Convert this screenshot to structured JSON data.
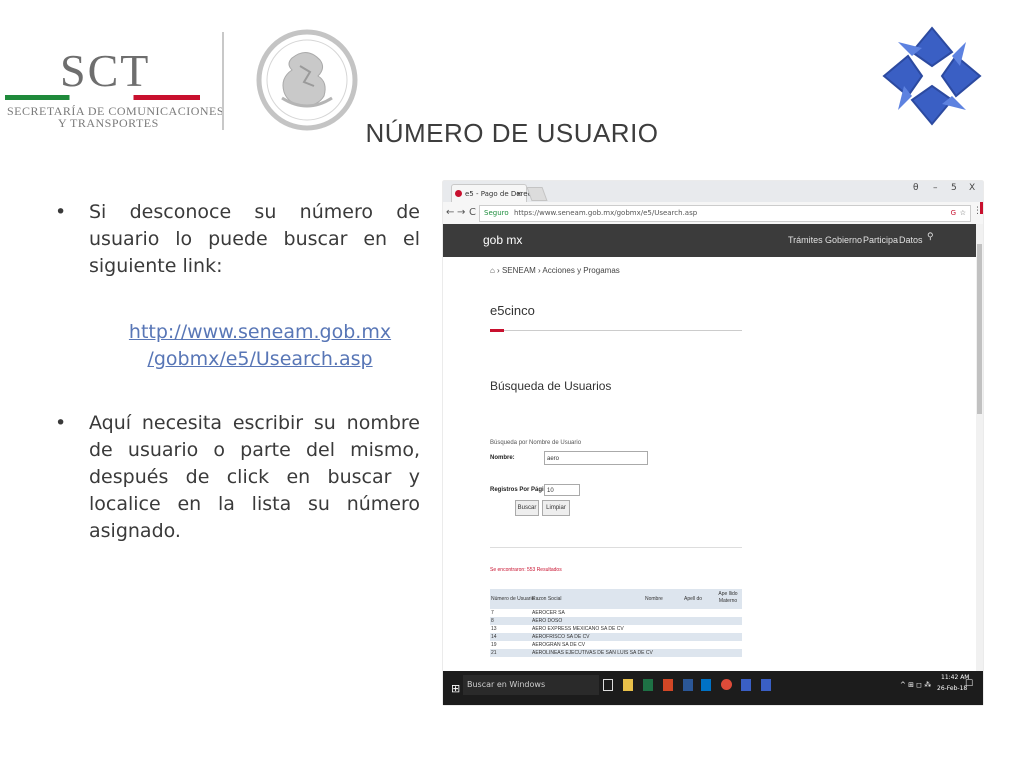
{
  "header": {
    "sct_letters": "SCT",
    "sct_line1": "SECRETARÍA DE COMUNICACIONES",
    "sct_line2": "Y TRANSPORTES",
    "seal_text": "ESTADOS UNIDOS MEXICANOS",
    "title": "NÚMERO DE USUARIO"
  },
  "content": {
    "bullet_symbol": "•",
    "bullet1": "Si desconoce su número de usuario lo puede buscar en el siguiente link:",
    "link": "http://www.seneam.gob.mx/gobmx/e5/Usearch.asp",
    "link_line1": "http://www.seneam.gob.mx",
    "link_line2": "/gobmx/e5/Usearch.asp",
    "bullet2": "Aquí necesita escribir su nombre de usuario o parte del mismo, después de click en buscar y localice en la lista su número asignado."
  },
  "browser": {
    "tab_title": "e5 - Pago de Derechos",
    "tab_close": "×",
    "win_user": "θ",
    "win_min": "–",
    "win_max": "5",
    "win_close": "X",
    "back": "←",
    "forward": "→",
    "reload": "C",
    "secure_label": "Seguro",
    "url": "https://www.seneam.gob.mx/gobmx/e5/Usearch.asp",
    "star": "☆",
    "menu": "⋮"
  },
  "site": {
    "brand": "gob mx",
    "nav": [
      "Trámites",
      "Gobierno",
      "Participa",
      "Datos"
    ],
    "search_icon": "⚲",
    "breadcrumb": "⌂ › SENEAM › Acciones y Progamas",
    "section": "e5cinco",
    "heading": "Búsqueda de Usuarios",
    "form_caption": "Búsqueda por Nombre de Usuario",
    "name_label": "Nombre:",
    "name_value": "aero",
    "reg_label": "Registros Por Página:",
    "reg_value": "10",
    "buscar": "Buscar",
    "limpiar": "Limpiar",
    "results": "Se encontraron: 553 Resultados",
    "table": {
      "headers": [
        "Número de Usuario",
        "Razon Social",
        "Nombre",
        "Apell do",
        "Ape llido Materno"
      ],
      "rows": [
        [
          "7",
          "AEROCER SA"
        ],
        [
          "8",
          "AERO DOSO"
        ],
        [
          "13",
          "AERO EXPRESS MEXICANO SA DE CV"
        ],
        [
          "14",
          "AEROFRISCO SA DE CV"
        ],
        [
          "19",
          "AEROGRAN SA DE CV"
        ],
        [
          "21",
          "AEROLINEAS EJECUTIVAS DE SAN LUIS SA DE CV"
        ]
      ]
    }
  },
  "taskbar": {
    "start": "⊞",
    "search": "Buscar en Windows",
    "tray": "^ ⊞ ◻ ⁂",
    "time": "11:42 AM",
    "date": "26-Feb-18",
    "notif": "☐"
  },
  "colors": {
    "accent_red": "#c8102e",
    "link_blue": "#5876b6",
    "gov_bar": "#3b3b3b",
    "table_stripe": "#dde5ee",
    "logo_blue": "#3a5fc4"
  }
}
